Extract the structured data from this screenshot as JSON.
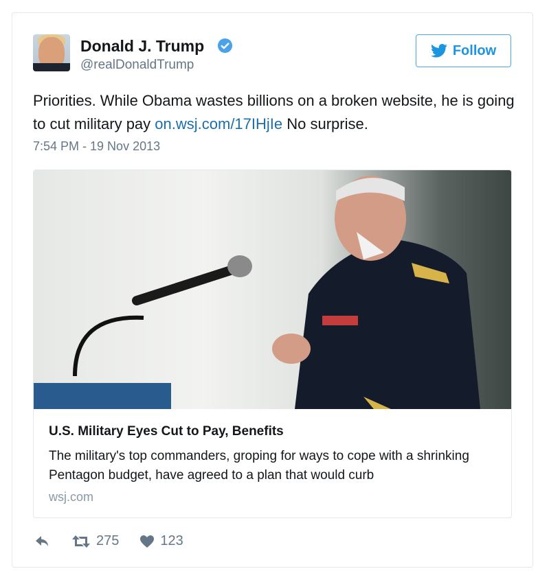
{
  "user": {
    "name": "Donald J. Trump",
    "handle": "@realDonaldTrump",
    "verified": true
  },
  "follow_label": "Follow",
  "tweet": {
    "text_before": "Priorities. While Obama wastes billions on a broken website, he is going to cut military pay ",
    "link": "on.wsj.com/17IHjIe",
    "text_after": " No surprise.",
    "timestamp": "7:54 PM - 19 Nov 2013"
  },
  "card": {
    "title": "U.S. Military Eyes Cut to Pay, Benefits",
    "description": "The military's top commanders, groping for ways to cope with a shrinking Pentagon budget, have agreed to a plan that would curb",
    "domain": "wsj.com"
  },
  "stats": {
    "retweets": "275",
    "likes": "123"
  },
  "colors": {
    "accent": "#1b95e0",
    "muted": "#657786"
  }
}
